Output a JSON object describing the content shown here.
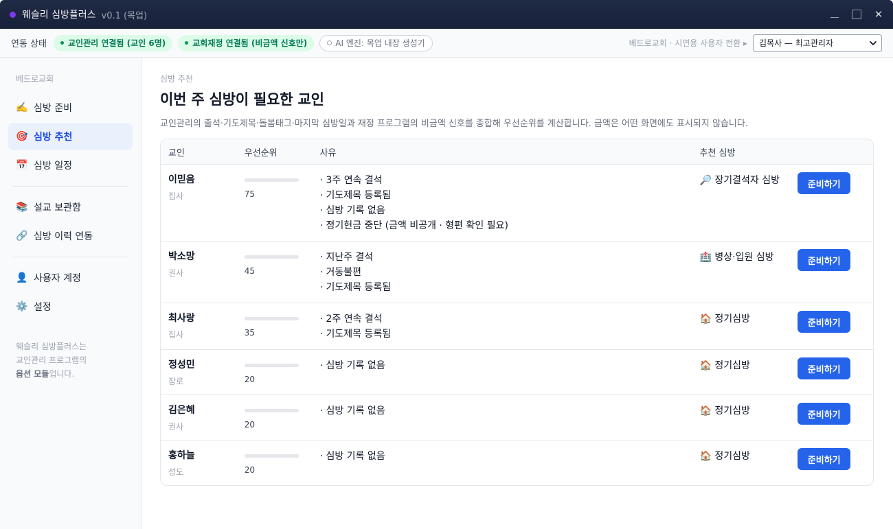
{
  "window": {
    "title": "웨슬리 심방플러스",
    "version": "v0.1 (목업)",
    "accent_color": "#7c3aed"
  },
  "status": {
    "label": "연동 상태",
    "pills": [
      {
        "text": "교인관리 연결됨 (교인 6명)",
        "state": "connected"
      },
      {
        "text": "교회재정 연결됨 (비금액 신호만)",
        "state": "connected"
      },
      {
        "text": "AI 엔진: 목업 내장 생성기",
        "state": "mock"
      }
    ],
    "church_note": "베드로교회 · 시연용 사용자 전환 ▸",
    "user_select": "김목사 — 최고관리자"
  },
  "sidebar": {
    "church": "베드로교회",
    "items": [
      {
        "icon": "✍️",
        "icon_name": "writing-hand-icon",
        "label": "심방 준비",
        "active": false
      },
      {
        "icon": "🎯",
        "icon_name": "target-icon",
        "label": "심방 추천",
        "active": true
      },
      {
        "icon": "📅",
        "icon_name": "calendar-icon",
        "label": "심방 일정",
        "active": false
      },
      {
        "icon": "📚",
        "icon_name": "books-icon",
        "label": "설교 보관함",
        "active": false
      },
      {
        "icon": "🔗",
        "icon_name": "link-icon",
        "label": "심방 이력 연동",
        "active": false
      },
      {
        "icon": "👤",
        "icon_name": "user-icon",
        "label": "사용자 계정",
        "active": false
      },
      {
        "icon": "⚙️",
        "icon_name": "gear-icon",
        "label": "설정",
        "active": false
      }
    ],
    "footer_line1": "웨슬리 심방플러스는",
    "footer_line2": "교인관리 프로그램의",
    "footer_bold": "옵션 모듈",
    "footer_tail": "입니다."
  },
  "main": {
    "eyebrow": "심방 추천",
    "title": "이번 주 심방이 필요한 교인",
    "description": "교인관리의 출석·기도제목·돌봄태그·마지막 심방일과 재정 프로그램의 비금액 신호를 종합해 우선순위를 계산합니다. 금액은 어떤 화면에도 표시되지 않습니다.",
    "columns": {
      "name": "교인",
      "priority": "우선순위",
      "reason": "사유",
      "recommend": "추천 심방",
      "action": ""
    },
    "action_label": "준비하기",
    "rows": [
      {
        "name": "이믿음",
        "role": "집사",
        "score": "75",
        "score_value": 75,
        "reasons": [
          "· 3주 연속 결석",
          "· 기도제목 등록됨",
          "· 심방 기록 없음",
          "· 정기헌금 중단 (금액 비공개 · 형편 확인 필요)"
        ],
        "recommend_icon": "🔎",
        "recommend": "장기결석자 심방"
      },
      {
        "name": "박소망",
        "role": "권사",
        "score": "45",
        "score_value": 45,
        "reasons": [
          "· 지난주 결석",
          "· 거동불편",
          "· 기도제목 등록됨"
        ],
        "recommend_icon": "🏥",
        "recommend": "병상·입원 심방"
      },
      {
        "name": "최사랑",
        "role": "집사",
        "score": "35",
        "score_value": 35,
        "reasons": [
          "· 2주 연속 결석",
          "· 기도제목 등록됨"
        ],
        "recommend_icon": "🏠",
        "recommend": "정기심방"
      },
      {
        "name": "정성민",
        "role": "장로",
        "score": "20",
        "score_value": 20,
        "reasons": [
          "· 심방 기록 없음"
        ],
        "recommend_icon": "🏠",
        "recommend": "정기심방"
      },
      {
        "name": "김은혜",
        "role": "권사",
        "score": "20",
        "score_value": 20,
        "reasons": [
          "· 심방 기록 없음"
        ],
        "recommend_icon": "🏠",
        "recommend": "정기심방"
      },
      {
        "name": "홍하늘",
        "role": "성도",
        "score": "20",
        "score_value": 20,
        "reasons": [
          "· 심방 기록 없음"
        ],
        "recommend_icon": "🏠",
        "recommend": "정기심방"
      }
    ]
  }
}
